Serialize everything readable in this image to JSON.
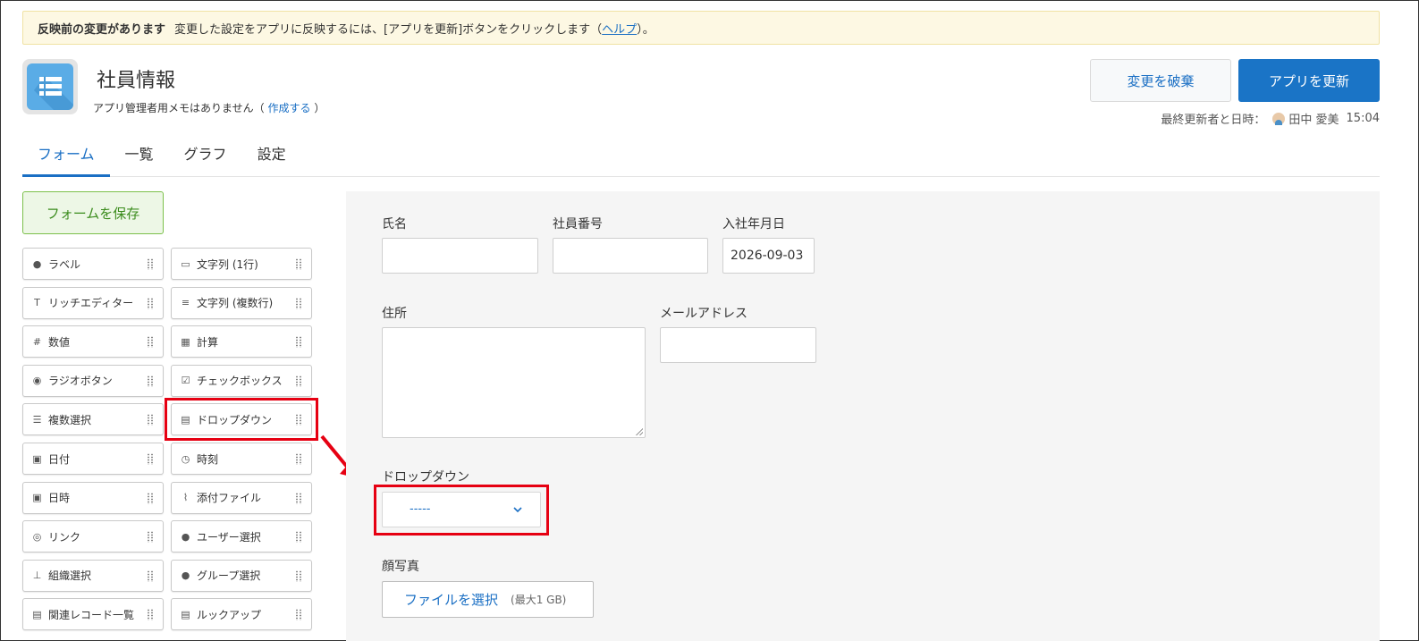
{
  "banner": {
    "title": "反映前の変更があります",
    "message": "変更した設定をアプリに反映するには、[アプリを更新]ボタンをクリックします（",
    "help_link": "ヘルプ",
    "suffix": "）。"
  },
  "app": {
    "title": "社員情報",
    "memo_prefix": "アプリ管理者用メモはありません（",
    "memo_link": "作成する",
    "memo_suffix": "）",
    "icon": "list-icon"
  },
  "actions": {
    "discard": "変更を破棄",
    "update": "アプリを更新",
    "updated_label": "最終更新者と日時：",
    "updated_user": "田中 愛美",
    "updated_time": "15:04"
  },
  "tabs": [
    "フォーム",
    "一覧",
    "グラフ",
    "設定"
  ],
  "palette": {
    "save": "フォームを保存",
    "items": [
      {
        "label": "ラベル",
        "icon": "tag-icon"
      },
      {
        "label": "文字列 (1行)",
        "icon": "text-single-icon"
      },
      {
        "label": "リッチエディター",
        "icon": "rich-text-icon"
      },
      {
        "label": "文字列 (複数行)",
        "icon": "text-multi-icon"
      },
      {
        "label": "数値",
        "icon": "number-icon"
      },
      {
        "label": "計算",
        "icon": "calculator-icon"
      },
      {
        "label": "ラジオボタン",
        "icon": "radio-icon"
      },
      {
        "label": "チェックボックス",
        "icon": "checkbox-icon"
      },
      {
        "label": "複数選択",
        "icon": "multi-select-icon"
      },
      {
        "label": "ドロップダウン",
        "icon": "dropdown-icon"
      },
      {
        "label": "日付",
        "icon": "calendar-icon"
      },
      {
        "label": "時刻",
        "icon": "clock-icon"
      },
      {
        "label": "日時",
        "icon": "datetime-icon"
      },
      {
        "label": "添付ファイル",
        "icon": "paperclip-icon"
      },
      {
        "label": "リンク",
        "icon": "globe-icon"
      },
      {
        "label": "ユーザー選択",
        "icon": "user-icon"
      },
      {
        "label": "組織選択",
        "icon": "org-icon"
      },
      {
        "label": "グループ選択",
        "icon": "group-icon"
      },
      {
        "label": "関連レコード一覧",
        "icon": "related-records-icon"
      },
      {
        "label": "ルックアップ",
        "icon": "lookup-icon"
      }
    ]
  },
  "form": {
    "name_label": "氏名",
    "employee_no_label": "社員番号",
    "join_date_label": "入社年月日",
    "join_date_value": "2026-09-03",
    "address_label": "住所",
    "email_label": "メールアドレス",
    "dropdown_label": "ドロップダウン",
    "dropdown_value": "-----",
    "photo_label": "顔写真",
    "file_button": "ファイルを選択",
    "file_limit": "(最大1 GB)"
  }
}
